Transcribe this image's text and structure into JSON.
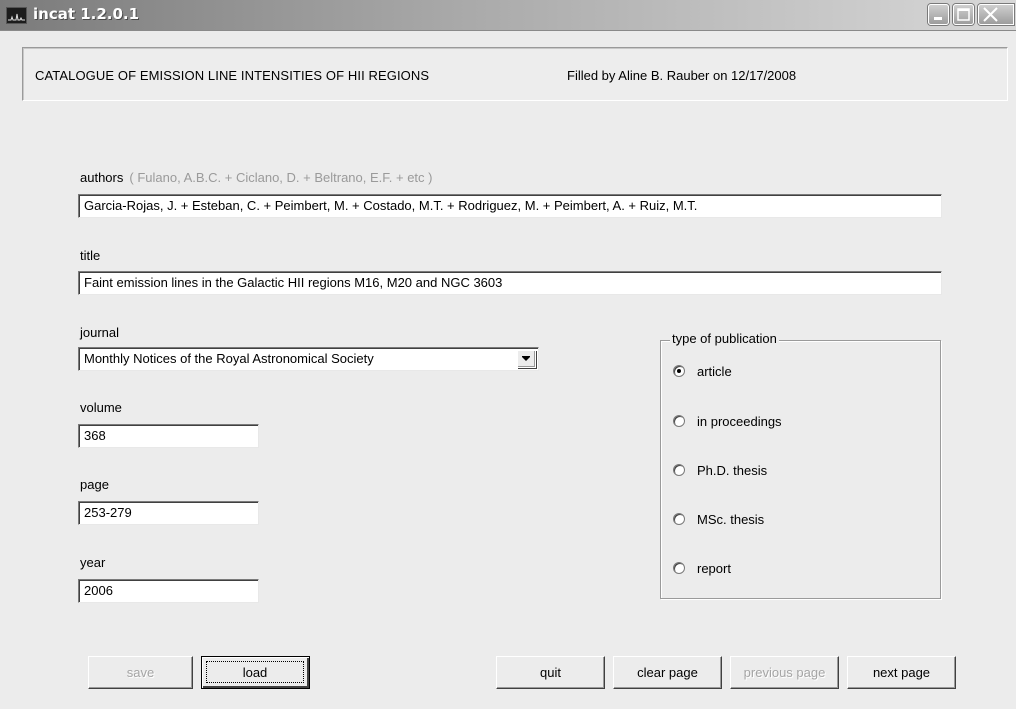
{
  "window": {
    "title": "incat 1.2.0.1",
    "controls": [
      "minimize-icon",
      "maximize-icon",
      "close-icon"
    ]
  },
  "header": {
    "catalogue_title": "CATALOGUE OF EMISSION LINE INTENSITIES OF HII REGIONS",
    "filled_by": "Filled by Aline B. Rauber on 12/17/2008"
  },
  "form": {
    "authors": {
      "label": "authors",
      "hint": "( Fulano, A.B.C. + Ciclano, D. + Beltrano, E.F. + etc )",
      "value": "Garcia-Rojas, J. + Esteban, C. + Peimbert, M. + Costado, M.T. + Rodriguez, M. + Peimbert, A. + Ruiz, M.T."
    },
    "title": {
      "label": "title",
      "value": "Faint emission lines in the Galactic HII regions M16, M20 and NGC 3603"
    },
    "journal": {
      "label": "journal",
      "selected": "Monthly Notices of the Royal Astronomical Society"
    },
    "volume": {
      "label": "volume",
      "value": "368"
    },
    "page": {
      "label": "page",
      "value": "253-279"
    },
    "year": {
      "label": "year",
      "value": "2006"
    }
  },
  "publication_type": {
    "legend": "type of publication",
    "options": [
      {
        "label": "article",
        "checked": true
      },
      {
        "label": "in proceedings",
        "checked": false
      },
      {
        "label": "Ph.D. thesis",
        "checked": false
      },
      {
        "label": "MSc. thesis",
        "checked": false
      },
      {
        "label": "report",
        "checked": false
      }
    ]
  },
  "buttons": {
    "save": "save",
    "load": "load",
    "quit": "quit",
    "clear_page": "clear page",
    "previous_page": "previous page",
    "next_page": "next page"
  }
}
